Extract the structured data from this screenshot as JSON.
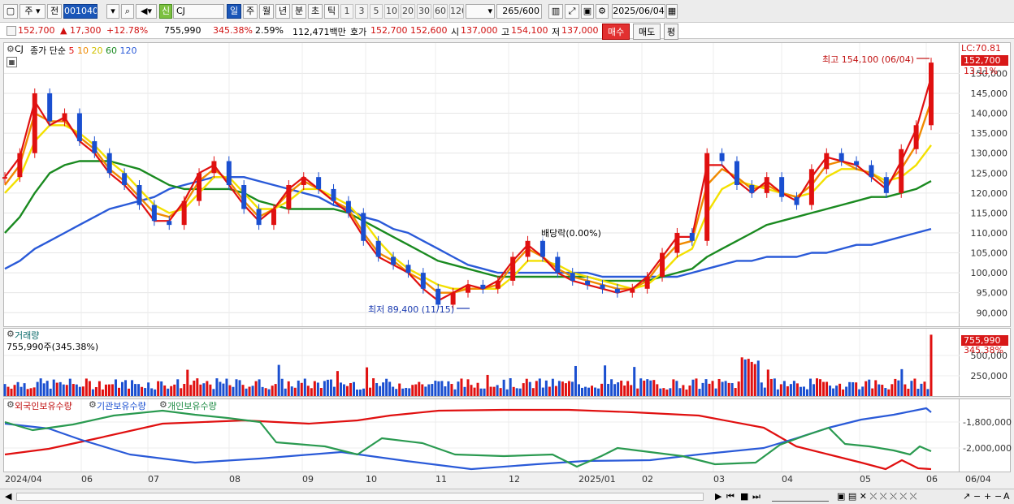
{
  "toolbar": {
    "type_label": "주",
    "prev_label": "전",
    "code": "001040",
    "sin_label": "신",
    "name": "CJ",
    "periods": [
      "일",
      "주",
      "월",
      "년",
      "분",
      "초",
      "틱"
    ],
    "active_period": "일",
    "intervals": [
      "1",
      "3",
      "5",
      "10",
      "20",
      "30",
      "60",
      "120"
    ],
    "count": "265",
    "count_total": "/600",
    "date": "2025/06/04"
  },
  "quote": {
    "price": "152,700",
    "change": "▲   17,300",
    "pct": "+12.78%",
    "volume": "755,990",
    "vol_ratio": "345.38%",
    "turnover": "2.59%",
    "amount": "112,471백만",
    "hoga_label": "호가",
    "ask": "152,700",
    "bid": "152,600",
    "open_label": "시",
    "open": "137,000",
    "high_label": "고",
    "high": "154,100",
    "low_label": "저",
    "low": "137,000",
    "buy_label": "매수",
    "sell_label": "매도",
    "eval_label": "평"
  },
  "price_panel": {
    "symbol": "CJ",
    "legend": [
      {
        "text": "종가 단순",
        "color": "#000000"
      },
      {
        "text": "5",
        "color": "#e01010"
      },
      {
        "text": "10",
        "color": "#f08a00"
      },
      {
        "text": "20",
        "color": "#e0d000"
      },
      {
        "text": "60",
        "color": "#1a8a20"
      },
      {
        "text": "120",
        "color": "#2a5ad8"
      }
    ],
    "max_label": "최고 154,100 (06/04)",
    "min_label": "최저 89,400 (11/15)",
    "event_label": "배당락(0.00%)",
    "lc_label": "LC:70.81",
    "price_tag": "152,700",
    "pct_tag": "13.11%"
  },
  "volume_panel": {
    "title": "거래량",
    "value": "755,990주(345.38%)",
    "tag1": "755,990",
    "tag2": "345.38%"
  },
  "holdings_panel": {
    "titles": [
      "외국인보유수량",
      "기관보유수량",
      "개인보유수량"
    ]
  },
  "x_labels": [
    "2024/04",
    "06",
    "07",
    "08",
    "09",
    "10",
    "11",
    "12",
    "2025/01",
    "02",
    "03",
    "04",
    "05",
    "06"
  ],
  "x_right_label": "06/04",
  "colors": {
    "up": "#e01010",
    "down": "#1a4fd0",
    "ma5": "#e01010",
    "ma10": "#f08a00",
    "ma20": "#f3e000",
    "ma60": "#1a8a20",
    "ma120": "#2a5ad8"
  },
  "chart_data": [
    {
      "type": "line",
      "title": "",
      "y_ticks": [
        90000,
        95000,
        100000,
        105000,
        110000,
        115000,
        120000,
        125000,
        130000,
        135000,
        140000,
        145000,
        150000
      ],
      "ylim": [
        87000,
        157000
      ],
      "x_labels": [
        "2024/04",
        "06",
        "07",
        "08",
        "09",
        "10",
        "11",
        "12",
        "2025/01",
        "02",
        "03",
        "04",
        "05",
        "06"
      ],
      "series": [
        {
          "name": "종가",
          "values": [
            124,
            130,
            145,
            138,
            140,
            133,
            130,
            125,
            122,
            117,
            113,
            112,
            118,
            125,
            128,
            122,
            116,
            112,
            116,
            122,
            124,
            121,
            118,
            115,
            108,
            104,
            102,
            100,
            96,
            92,
            95,
            97,
            96,
            98,
            104,
            108,
            104,
            100,
            98,
            97,
            96,
            95,
            96,
            99,
            105,
            110,
            108,
            130,
            128,
            122,
            120,
            124,
            119,
            117,
            126,
            130,
            128,
            127,
            124,
            120,
            131,
            137,
            152.7
          ]
        },
        {
          "name": "5",
          "values": [
            124,
            129,
            143,
            137,
            139,
            133,
            130,
            125,
            122,
            118,
            113,
            113,
            118,
            125,
            127,
            122,
            117,
            113,
            116,
            121,
            124,
            121,
            118,
            115,
            109,
            104,
            102,
            100,
            96,
            93,
            95,
            97,
            96,
            98,
            103,
            107,
            104,
            100,
            98,
            97,
            96,
            95,
            96,
            99,
            104,
            109,
            109,
            127,
            127,
            123,
            120,
            123,
            120,
            118,
            124,
            129,
            128,
            127,
            124,
            121,
            128,
            136,
            149
          ]
        },
        {
          "name": "10",
          "values": [
            122,
            127,
            140,
            138,
            138,
            134,
            131,
            126,
            123,
            119,
            115,
            114,
            117,
            123,
            126,
            123,
            118,
            114,
            116,
            120,
            123,
            121,
            118,
            116,
            110,
            105,
            103,
            100,
            98,
            95,
            95,
            96,
            96,
            97,
            102,
            106,
            104,
            101,
            99,
            98,
            97,
            96,
            96,
            98,
            103,
            107,
            108,
            122,
            126,
            124,
            121,
            122,
            120,
            119,
            122,
            127,
            128,
            126,
            125,
            122,
            126,
            132,
            143
          ]
        },
        {
          "name": "20",
          "values": [
            120,
            124,
            133,
            137,
            137,
            135,
            132,
            128,
            125,
            121,
            117,
            115,
            116,
            120,
            124,
            124,
            120,
            116,
            116,
            118,
            121,
            121,
            119,
            117,
            113,
            108,
            104,
            101,
            99,
            97,
            96,
            96,
            96,
            96,
            99,
            103,
            103,
            102,
            100,
            99,
            98,
            97,
            96,
            97,
            100,
            104,
            106,
            115,
            121,
            123,
            122,
            121,
            120,
            119,
            120,
            124,
            126,
            126,
            125,
            123,
            124,
            127,
            132
          ]
        },
        {
          "name": "60",
          "values": [
            110,
            114,
            120,
            125,
            127,
            128,
            128,
            128,
            127,
            126,
            124,
            122,
            121,
            121,
            121,
            121,
            120,
            118,
            117,
            116,
            116,
            116,
            116,
            115,
            113,
            111,
            109,
            107,
            105,
            103,
            102,
            101,
            100,
            99,
            99,
            99,
            99,
            99,
            99,
            99,
            98,
            98,
            98,
            98,
            99,
            100,
            101,
            104,
            106,
            108,
            110,
            112,
            113,
            114,
            115,
            116,
            117,
            118,
            119,
            119,
            120,
            121,
            123
          ]
        },
        {
          "name": "120",
          "values": [
            101,
            103,
            106,
            108,
            110,
            112,
            114,
            116,
            117,
            118,
            119,
            121,
            122,
            123,
            124,
            124,
            124,
            123,
            122,
            121,
            120,
            119,
            117,
            116,
            114,
            113,
            111,
            110,
            108,
            106,
            104,
            102,
            101,
            100,
            100,
            100,
            100,
            100,
            100,
            100,
            99,
            99,
            99,
            99,
            99,
            99,
            100,
            101,
            102,
            103,
            103,
            104,
            104,
            104,
            105,
            105,
            106,
            107,
            107,
            108,
            109,
            110,
            111
          ]
        }
      ]
    },
    {
      "type": "bar",
      "title": "",
      "y_ticks": [
        250000,
        500000
      ],
      "ylim": [
        0,
        800000
      ]
    },
    {
      "type": "line",
      "title": "",
      "y_ticks": [
        -1800000,
        -2000000
      ],
      "series": [
        {
          "name": "외국인보유수량"
        },
        {
          "name": "기관보유수량"
        },
        {
          "name": "개인보유수량"
        }
      ]
    }
  ]
}
